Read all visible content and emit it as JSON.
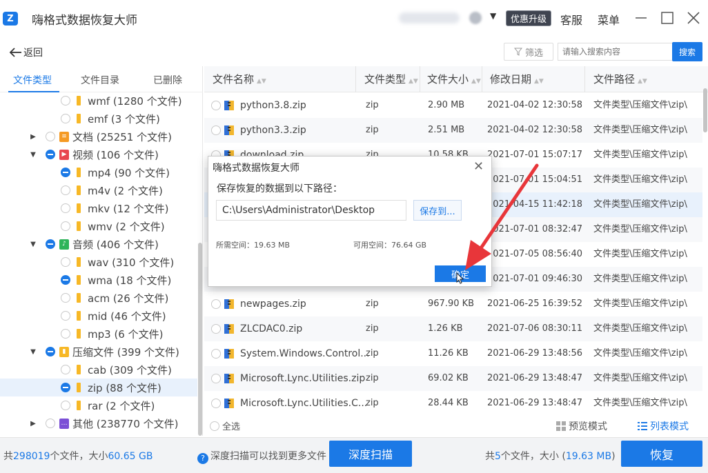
{
  "app": {
    "logo": "Z",
    "title": "嗨格式数据恢复大师",
    "upgrade": "优惠升级",
    "service": "客服",
    "menu": "菜单",
    "minimize": "—",
    "maximize": "☐",
    "close": "✕"
  },
  "toolbar": {
    "back": "返回",
    "filter": "筛选",
    "search_placeholder": "请输入搜索内容",
    "search_btn": "搜索"
  },
  "left_tabs": [
    "文件类型",
    "文件目录",
    "已删除"
  ],
  "tree": [
    {
      "label": "wmf (1280 个文件)"
    },
    {
      "label": "emf (3 个文件)"
    },
    {
      "label": "文档 (25251 个文件)"
    },
    {
      "label": "视频 (106 个文件)"
    },
    {
      "label": "mp4 (90 个文件)"
    },
    {
      "label": "m4v (2 个文件)"
    },
    {
      "label": "mkv (12 个文件)"
    },
    {
      "label": "wmv (2 个文件)"
    },
    {
      "label": "音频 (406 个文件)"
    },
    {
      "label": "wav (310 个文件)"
    },
    {
      "label": "wma (18 个文件)"
    },
    {
      "label": "acm (26 个文件)"
    },
    {
      "label": "mid (46 个文件)"
    },
    {
      "label": "mp3 (6 个文件)"
    },
    {
      "label": "压缩文件 (399 个文件)"
    },
    {
      "label": "cab (309 个文件)"
    },
    {
      "label": "zip (88 个文件)"
    },
    {
      "label": "rar (2 个文件)"
    },
    {
      "label": "其他 (238770 个文件)"
    }
  ],
  "table": {
    "headers": [
      "文件名称",
      "文件类型",
      "文件大小",
      "修改日期",
      "文件路径"
    ],
    "rows": [
      {
        "name": "python3.8.zip",
        "type": "zip",
        "size": "2.90 MB",
        "date": "2021-04-02 12:30:58",
        "path": "文件类型\\压缩文件\\zip\\"
      },
      {
        "name": "python3.3.zip",
        "type": "zip",
        "size": "2.51 MB",
        "date": "2021-04-02 12:30:58",
        "path": "文件类型\\压缩文件\\zip\\"
      },
      {
        "name": "download.zip",
        "type": "zip",
        "size": "10.58 KB",
        "date": "2021-07-01 15:07:17",
        "path": "文件类型\\压缩文件\\zip\\"
      },
      {
        "name": "",
        "type": "",
        "size": "",
        "date": "2021-07-01 15:04:51",
        "path": "文件类型\\压缩文件\\zip\\"
      },
      {
        "name": "",
        "type": "",
        "size": "",
        "date": "2021-04-15 11:42:18",
        "path": "文件类型\\压缩文件\\zip\\"
      },
      {
        "name": "",
        "type": "",
        "size": "",
        "date": "2021-07-01 08:32:47",
        "path": "文件类型\\压缩文件\\zip\\"
      },
      {
        "name": "",
        "type": "",
        "size": "",
        "date": "2021-07-05 08:56:40",
        "path": "文件类型\\压缩文件\\zip\\"
      },
      {
        "name": "",
        "type": "",
        "size": "",
        "date": "2021-07-01 09:46:30",
        "path": "文件类型\\压缩文件\\zip\\"
      },
      {
        "name": "newpages.zip",
        "type": "zip",
        "size": "967.90 KB",
        "date": "2021-06-25 16:39:52",
        "path": "文件类型\\压缩文件\\zip\\"
      },
      {
        "name": "ZLCDAC0.zip",
        "type": "zip",
        "size": "1.26 KB",
        "date": "2021-07-06 08:30:11",
        "path": "文件类型\\压缩文件\\zip\\"
      },
      {
        "name": "System.Windows.Control...",
        "type": "zip",
        "size": "11.26 KB",
        "date": "2021-06-29 13:48:56",
        "path": "文件类型\\压缩文件\\zip\\"
      },
      {
        "name": "Microsoft.Lync.Utilities.zip",
        "type": "zip",
        "size": "69.02 KB",
        "date": "2021-06-29 13:48:47",
        "path": "文件类型\\压缩文件\\zip\\"
      },
      {
        "name": "Microsoft.Lync.Utilities.C...",
        "type": "zip",
        "size": "28.44 KB",
        "date": "2021-06-29 13:48:47",
        "path": "文件类型\\压缩文件\\zip\\"
      }
    ]
  },
  "table_footer": {
    "select_all": "全选",
    "preview_mode": "预览模式",
    "list_mode": "列表模式"
  },
  "status": {
    "total_prefix": "共",
    "total_files": "298019",
    "total_mid": "个文件，大小",
    "total_size": "60.65 GB",
    "deep_hint": "深度扫描可以找到更多文件",
    "deep_btn": "深度扫描",
    "sel_prefix": "共",
    "sel_count": "5",
    "sel_mid": "个文件，大小 (",
    "sel_size": "19.63 MB",
    "sel_suffix": ")",
    "recover_btn": "恢复"
  },
  "dialog": {
    "title": "嗨格式数据恢复大师",
    "close": "✕",
    "prompt": "保存恢复的数据到以下路径：",
    "path_value": "C:\\Users\\Administrator\\Desktop",
    "save_to": "保存到...",
    "required_space": "所需空间：19.63 MB",
    "available_space": "可用空间：76.64 GB",
    "ok": "确定"
  },
  "colors": {
    "accent": "#1b79e6",
    "annotation_arrow": "#e8363a",
    "folder": "#f7b826",
    "doc_icon": "#f59a23",
    "video_icon": "#e8454f",
    "audio_icon": "#2fb45a",
    "other_icon": "#7b4fd6"
  }
}
